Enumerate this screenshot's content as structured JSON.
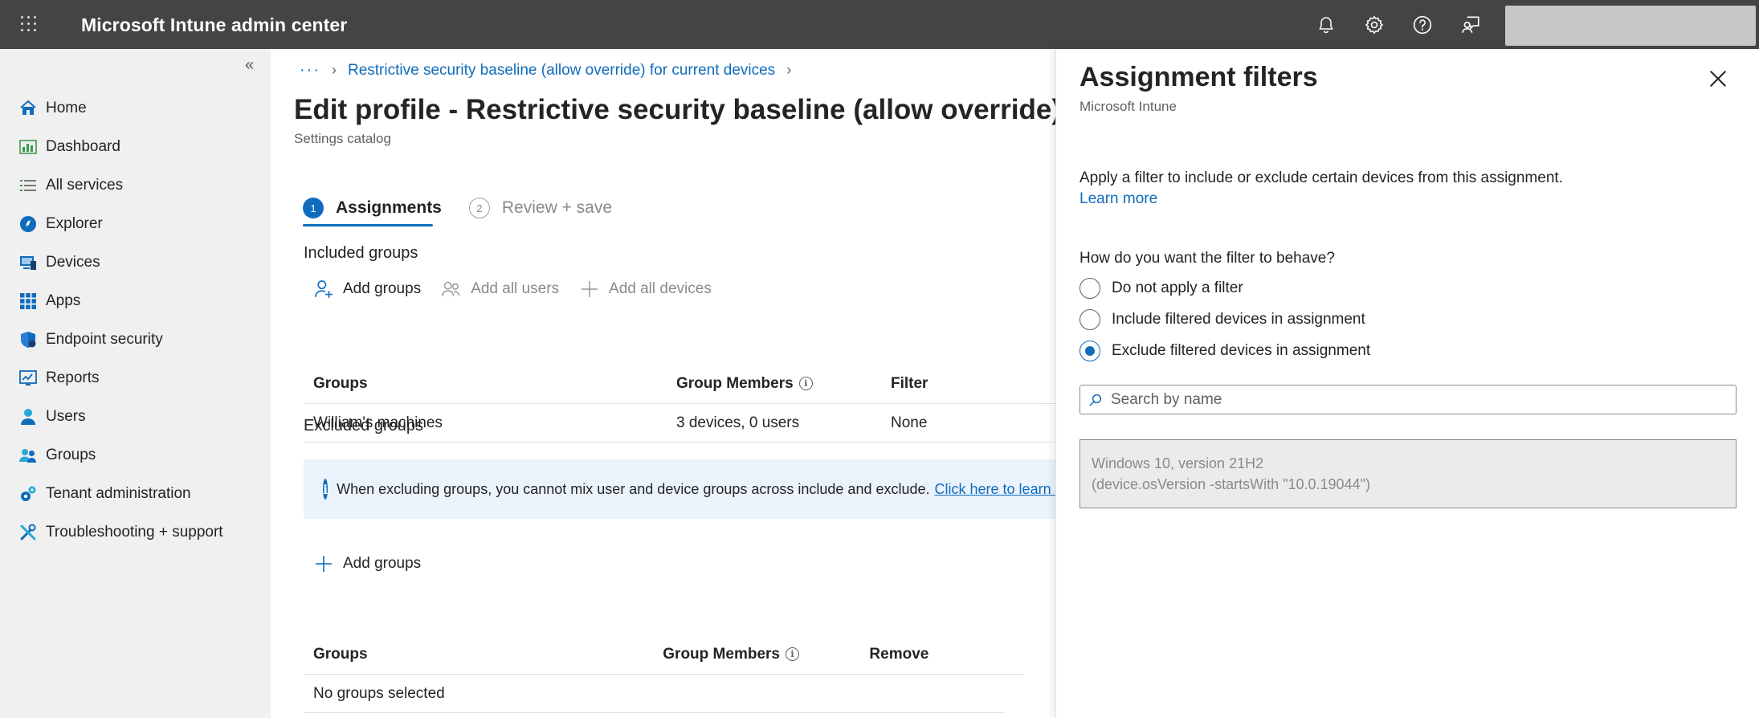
{
  "topbar": {
    "title": "Microsoft Intune admin center",
    "icons": [
      "waffle-icon",
      "bell-icon",
      "gear-icon",
      "help-icon",
      "feedback-icon"
    ]
  },
  "nav": {
    "collapse": "«",
    "items": [
      {
        "label": "Home",
        "icon": "home-icon"
      },
      {
        "label": "Dashboard",
        "icon": "dashboard-icon"
      },
      {
        "label": "All services",
        "icon": "list-icon"
      },
      {
        "label": "Explorer",
        "icon": "explorer-icon"
      },
      {
        "label": "Devices",
        "icon": "devices-icon"
      },
      {
        "label": "Apps",
        "icon": "apps-icon"
      },
      {
        "label": "Endpoint security",
        "icon": "shield-icon"
      },
      {
        "label": "Reports",
        "icon": "reports-icon"
      },
      {
        "label": "Users",
        "icon": "user-icon"
      },
      {
        "label": "Groups",
        "icon": "groups-icon"
      },
      {
        "label": "Tenant administration",
        "icon": "tenant-gear-icon"
      },
      {
        "label": "Troubleshooting + support",
        "icon": "tools-icon"
      }
    ]
  },
  "main": {
    "breadcrumb": {
      "dots": "···",
      "link": "Restrictive security baseline (allow override) for current devices"
    },
    "title": "Edit profile - Restrictive security baseline (allow override) for current devices",
    "subtitle": "Settings catalog",
    "steps": [
      {
        "num": "1",
        "label": "Assignments"
      },
      {
        "num": "2",
        "label": "Review + save"
      }
    ],
    "included": {
      "heading": "Included groups",
      "actions": {
        "add_groups": "Add groups",
        "add_all_users": "Add all users",
        "add_all_devices": "Add all devices"
      },
      "headers": {
        "groups": "Groups",
        "members": "Group Members",
        "filter": "Filter"
      },
      "rows": [
        {
          "group": "William's machines",
          "members": "3 devices, 0 users",
          "filter": "None"
        }
      ]
    },
    "excluded": {
      "heading": "Excluded groups",
      "info": "When excluding groups, you cannot mix user and device groups across include and exclude.",
      "info_link": "Click here to learn more",
      "add_groups": "Add groups",
      "headers": {
        "groups": "Groups",
        "members": "Group Members",
        "remove": "Remove"
      },
      "empty": "No groups selected"
    }
  },
  "panel": {
    "title": "Assignment filters",
    "subtitle": "Microsoft Intune",
    "description": "Apply a filter to include or exclude certain devices from this assignment.",
    "learn_more": "Learn more",
    "question": "How do you want the filter to behave?",
    "options": [
      {
        "label": "Do not apply a filter",
        "selected": false
      },
      {
        "label": "Include filtered devices in assignment",
        "selected": false
      },
      {
        "label": "Exclude filtered devices in assignment",
        "selected": true
      }
    ],
    "search_placeholder": "Search by name",
    "filter_name": "Windows 10, version 21H2",
    "filter_rule": "(device.osVersion -startsWith \"10.0.19044\")"
  },
  "colors": {
    "accent": "#0f6cbd",
    "topbar": "#444444",
    "nav_bg": "#f0f0f0",
    "info_bg": "#ebf3fc"
  }
}
